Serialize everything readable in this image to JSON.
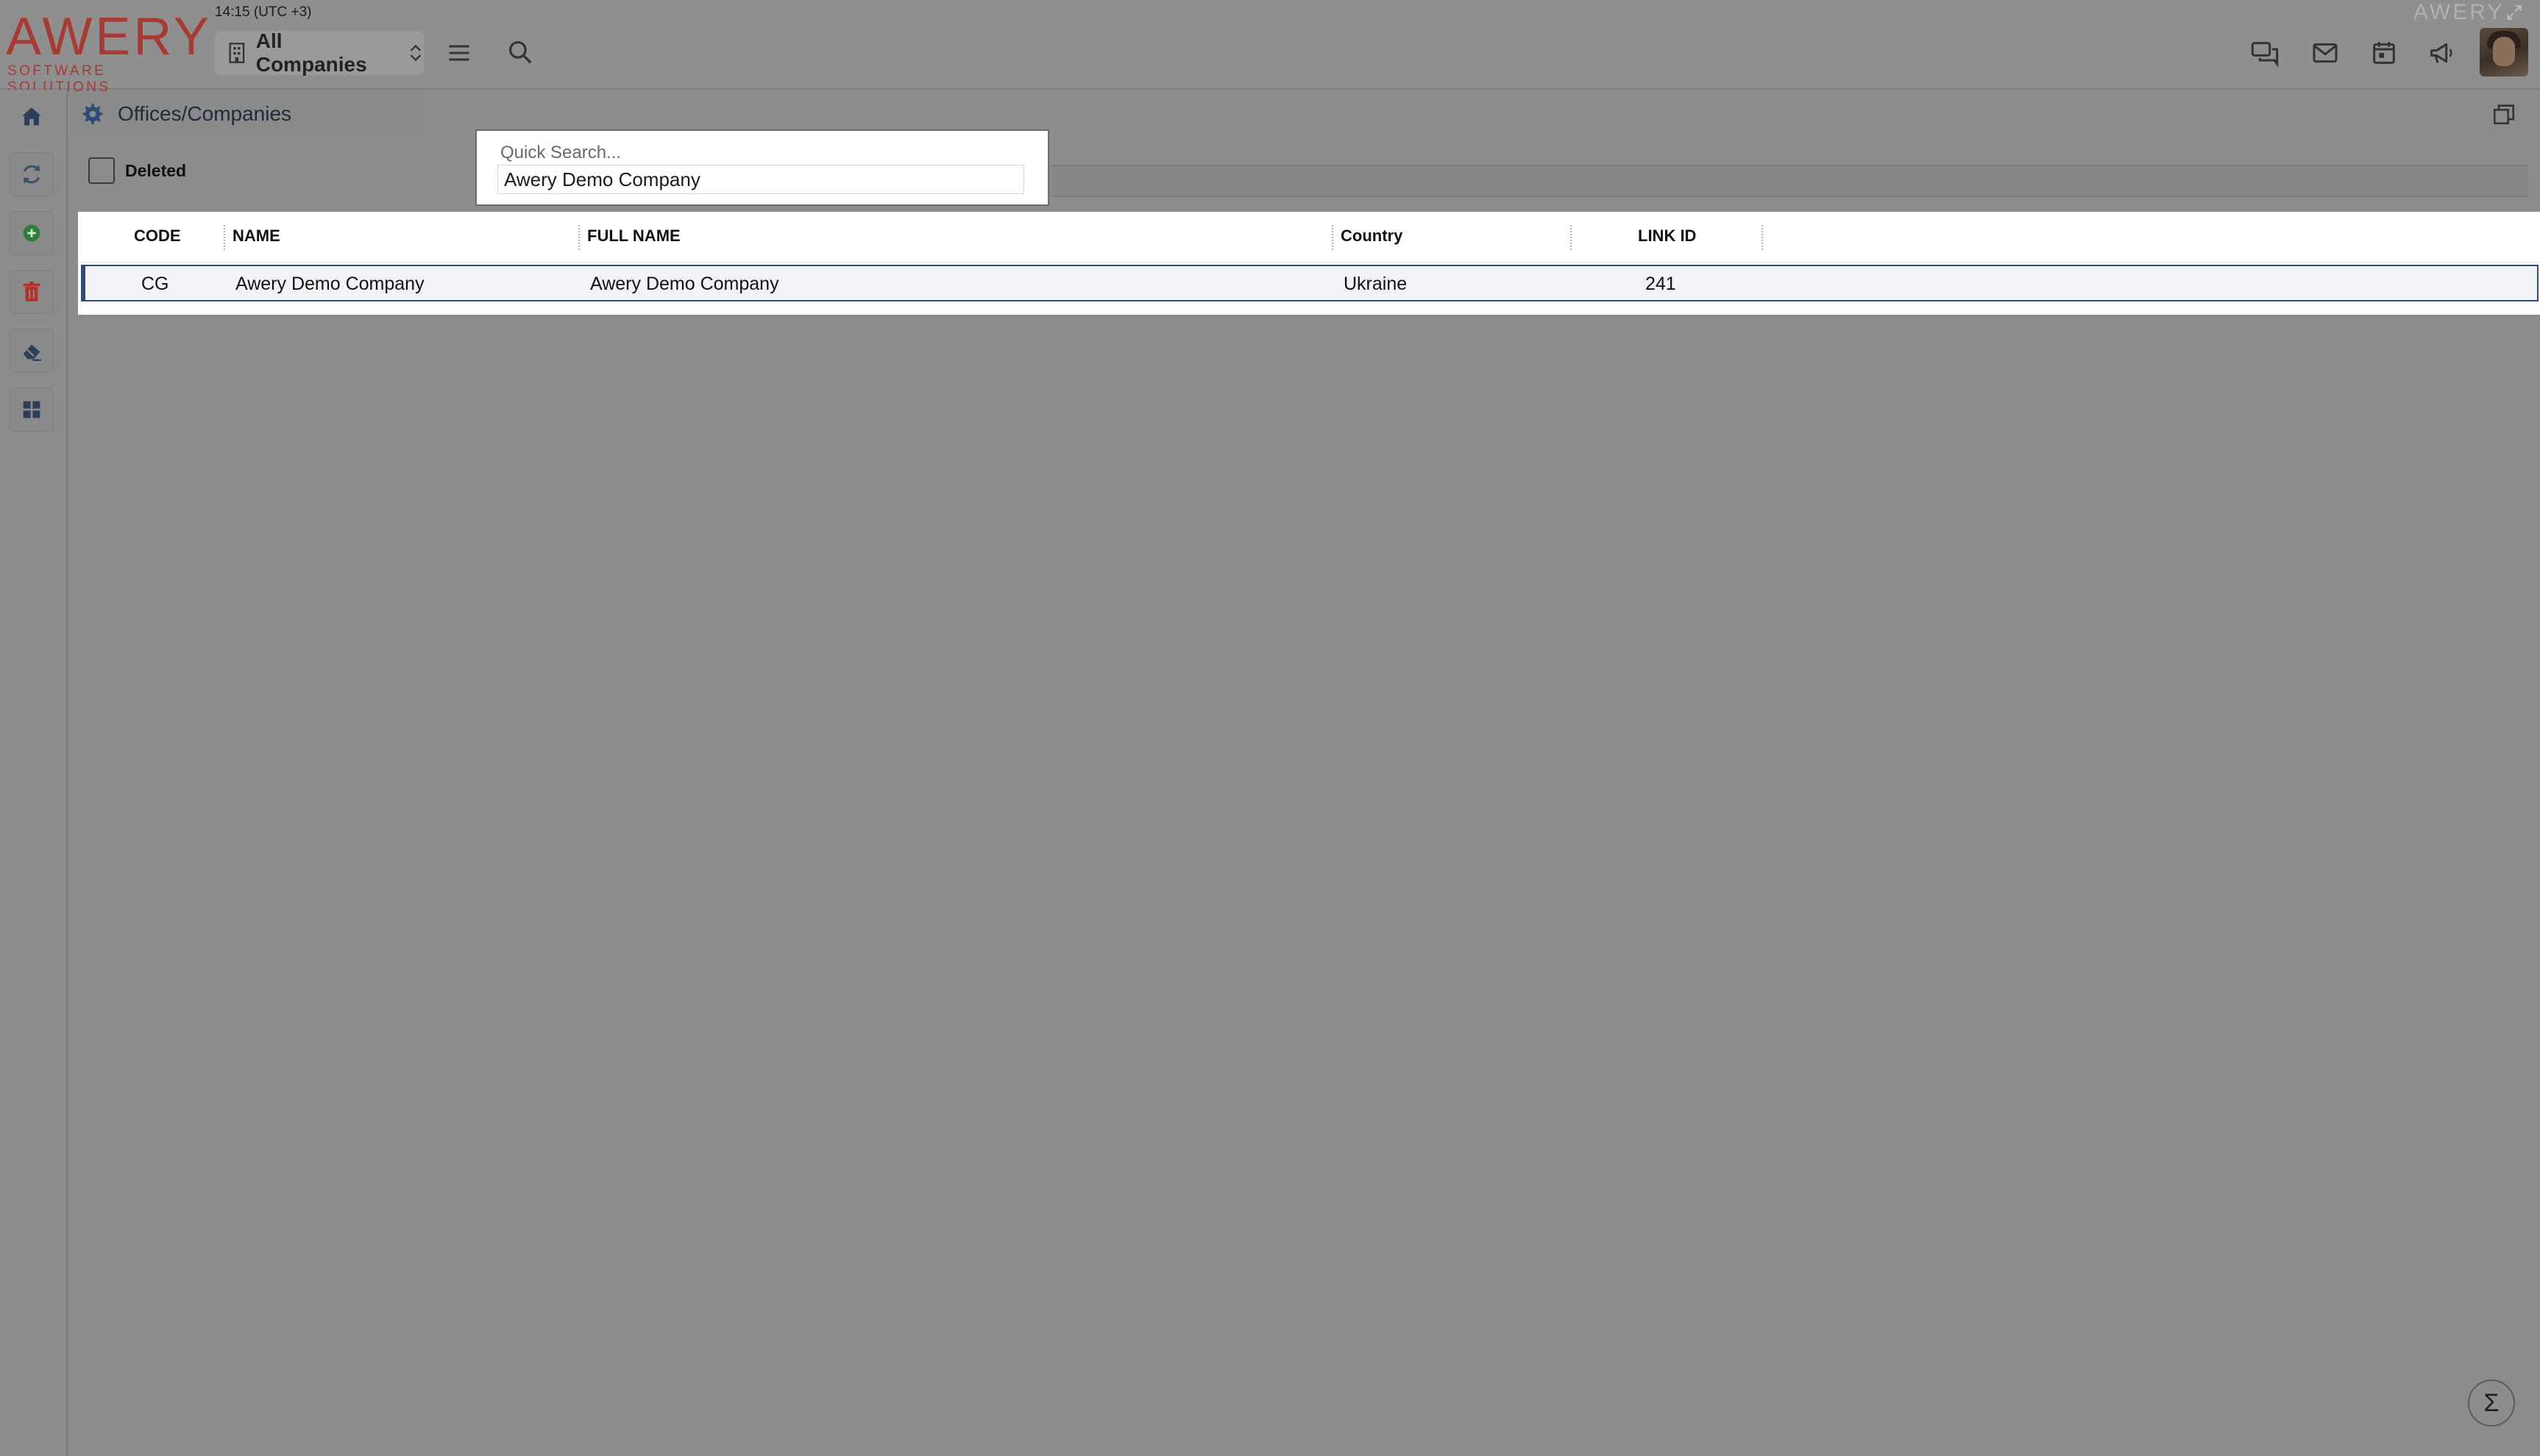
{
  "header": {
    "logo_word": "AWERY",
    "logo_sub": "SOFTWARE SOLUTIONS",
    "clock": "14:15 (UTC +3)",
    "company_selector": "All Companies",
    "brand_small": "AWERY"
  },
  "icons": {
    "building": "building-icon",
    "hamburger": "menu-icon",
    "search": "search-icon",
    "chat": "chat-icon",
    "mail": "mail-icon",
    "calendar": "calendar-icon",
    "megaphone": "megaphone-icon",
    "home": "home-icon",
    "refresh": "refresh-icon",
    "add": "add-icon",
    "delete": "trash-icon",
    "eraser": "eraser-icon",
    "grid": "grid-icon",
    "settings": "gear-icon",
    "restore": "restore-window-icon",
    "expand": "expand-icon",
    "sigma": "sigma-icon"
  },
  "colors": {
    "brand": "#a83a34",
    "add_green": "#2f7d3a",
    "delete_red": "#b3322c",
    "selected_row_border": "#2c4b7a"
  },
  "tab": {
    "title": "Offices/Companies"
  },
  "filters": {
    "deleted_label": "Deleted",
    "deleted_checked": false
  },
  "quick_search": {
    "placeholder": "Quick Search...",
    "value": "Awery Demo Company"
  },
  "grid": {
    "columns": [
      "CODE",
      "NAME",
      "FULL NAME",
      "Country",
      "LINK ID"
    ],
    "rows": [
      {
        "code": "CG",
        "name": "Awery Demo Company",
        "full_name": "Awery Demo Company",
        "country": "Ukraine",
        "link_id": "241"
      }
    ]
  },
  "footer": {
    "sigma": "Σ"
  }
}
